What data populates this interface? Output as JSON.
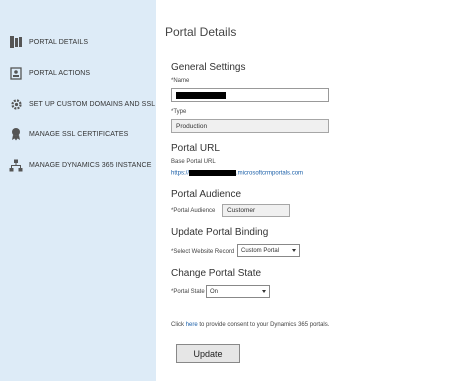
{
  "sidebar": {
    "items": [
      {
        "label": "PORTAL DETAILS",
        "icon": "portal-details-icon"
      },
      {
        "label": "PORTAL ACTIONS",
        "icon": "portal-actions-icon"
      },
      {
        "label": "SET UP CUSTOM DOMAINS AND SSL",
        "icon": "gear-icon"
      },
      {
        "label": "MANAGE SSL CERTIFICATES",
        "icon": "certificate-icon"
      },
      {
        "label": "MANAGE DYNAMICS 365 INSTANCE",
        "icon": "hierarchy-icon"
      }
    ]
  },
  "main": {
    "title": "Portal Details",
    "general": {
      "heading": "General Settings",
      "name_label": "*Name",
      "type_label": "*Type",
      "type_value": "Production"
    },
    "url": {
      "heading": "Portal URL",
      "base_label": "Base Portal URL",
      "url_prefix": "https://",
      "url_suffix": ".microsoftcrmportals.com"
    },
    "audience": {
      "heading": "Portal Audience",
      "label": "*Portal Audience",
      "value": "Customer"
    },
    "binding": {
      "heading": "Update Portal Binding",
      "label": "*Select Website Record",
      "value": "Custom Portal"
    },
    "state": {
      "heading": "Change Portal State",
      "label": "*Portal State",
      "value": "On"
    },
    "consent": {
      "prefix": "Click ",
      "link": "here",
      "suffix": " to provide consent to your Dynamics 365 portals."
    },
    "update_button": "Update"
  },
  "colors": {
    "sidebar_bg": "#ddebf7",
    "link": "#1a5fa8"
  }
}
